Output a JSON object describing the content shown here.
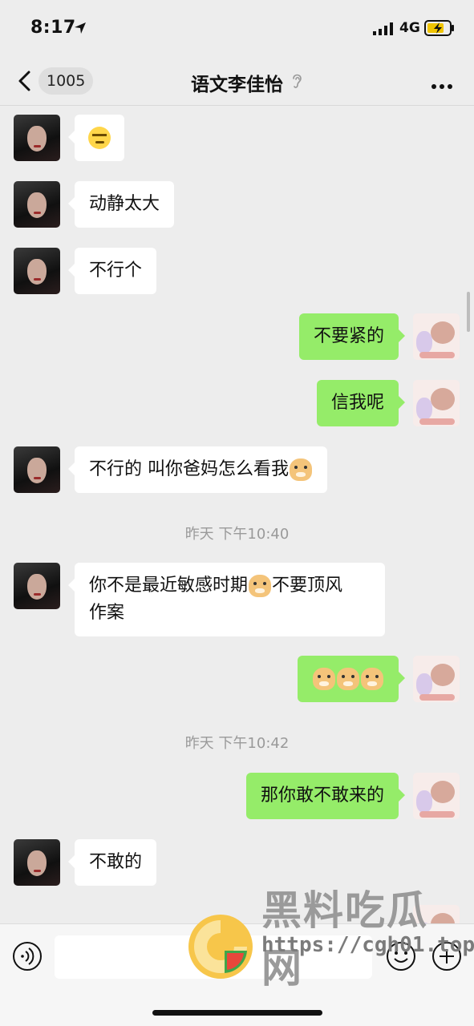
{
  "status_bar": {
    "time": "8:17",
    "network": "4G"
  },
  "nav": {
    "unread_count": "1005",
    "title": "语文李佳怡"
  },
  "messages": {
    "m1": {
      "side": "in",
      "text": ""
    },
    "m2": {
      "side": "in",
      "text": "动静太大"
    },
    "m3": {
      "side": "in",
      "text": "不行个"
    },
    "m4": {
      "side": "out",
      "text": "不要紧的"
    },
    "m5": {
      "side": "out",
      "text": "信我呢"
    },
    "m6": {
      "side": "in",
      "text": "不行的 叫你爸妈怎么看我"
    },
    "t1": "昨天 下午10:40",
    "m7": {
      "side": "in",
      "line1_a": "你不是最近敏感时期",
      "line1_b": "不要顶风",
      "line2": "作案"
    },
    "m8": {
      "side": "out",
      "text": ""
    },
    "t2": "昨天 下午10:42",
    "m9": {
      "side": "out",
      "text": "那你敢不敢来的"
    },
    "m10": {
      "side": "in",
      "text": "不敢的"
    }
  },
  "input": {
    "placeholder": ""
  },
  "watermark": {
    "title": "黑料吃瓜网",
    "url": "https://cgh01.top"
  },
  "icons": [
    "location-arrow-icon",
    "signal-icon",
    "battery-charging-icon",
    "back-chevron-icon",
    "mute-ear-icon",
    "more-dots-icon",
    "voice-icon",
    "emoji-icon",
    "plus-icon",
    "doge-emoji",
    "smirk-emoji"
  ],
  "colors": {
    "background": "#ededed",
    "incoming_bubble": "#ffffff",
    "outgoing_bubble": "#95ec69",
    "timestamp": "#9a9a9a"
  }
}
